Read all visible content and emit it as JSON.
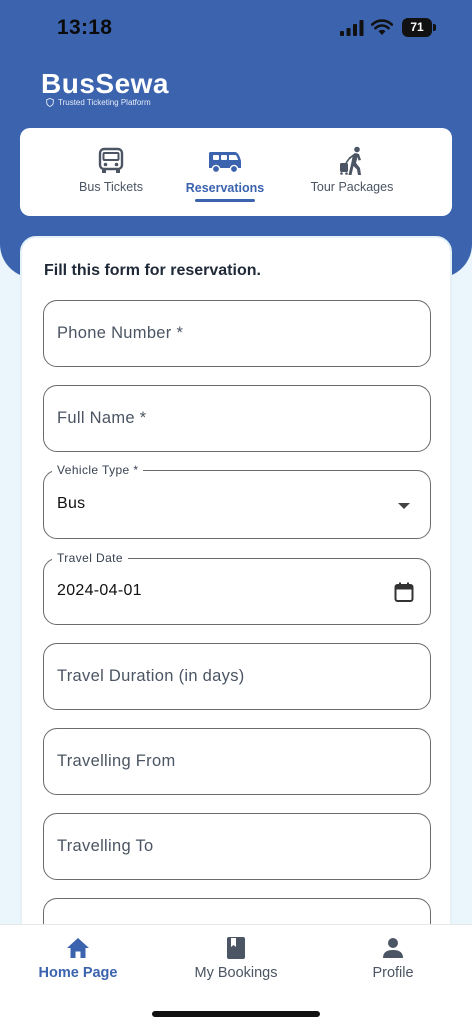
{
  "status_bar": {
    "time": "13:18",
    "battery": "71"
  },
  "brand": {
    "name": "BusSewa",
    "tagline": "Trusted Ticketing Platform"
  },
  "tabs": [
    {
      "label": "Bus Tickets",
      "icon": "bus-icon",
      "active": false
    },
    {
      "label": "Reservations",
      "icon": "van-icon",
      "active": true
    },
    {
      "label": "Tour Packages",
      "icon": "traveler-icon",
      "active": false
    }
  ],
  "form": {
    "title": "Fill this form for reservation.",
    "phone": {
      "placeholder": "Phone Number *"
    },
    "full_name": {
      "placeholder": "Full Name *"
    },
    "vehicle_type": {
      "label": "Vehicle Type *",
      "value": "Bus"
    },
    "travel_date": {
      "label": "Travel Date",
      "value": "2024-04-01"
    },
    "duration": {
      "placeholder": "Travel Duration (in days)"
    },
    "from": {
      "placeholder": "Travelling From"
    },
    "to": {
      "placeholder": "Travelling To"
    }
  },
  "bottom_nav": [
    {
      "label": "Home Page",
      "icon": "home-icon",
      "active": true
    },
    {
      "label": "My Bookings",
      "icon": "book-icon",
      "active": false
    },
    {
      "label": "Profile",
      "icon": "person-icon",
      "active": false
    }
  ],
  "colors": {
    "primary": "#3b63ae",
    "background": "#eaf6fb",
    "text": "#1f2937"
  }
}
